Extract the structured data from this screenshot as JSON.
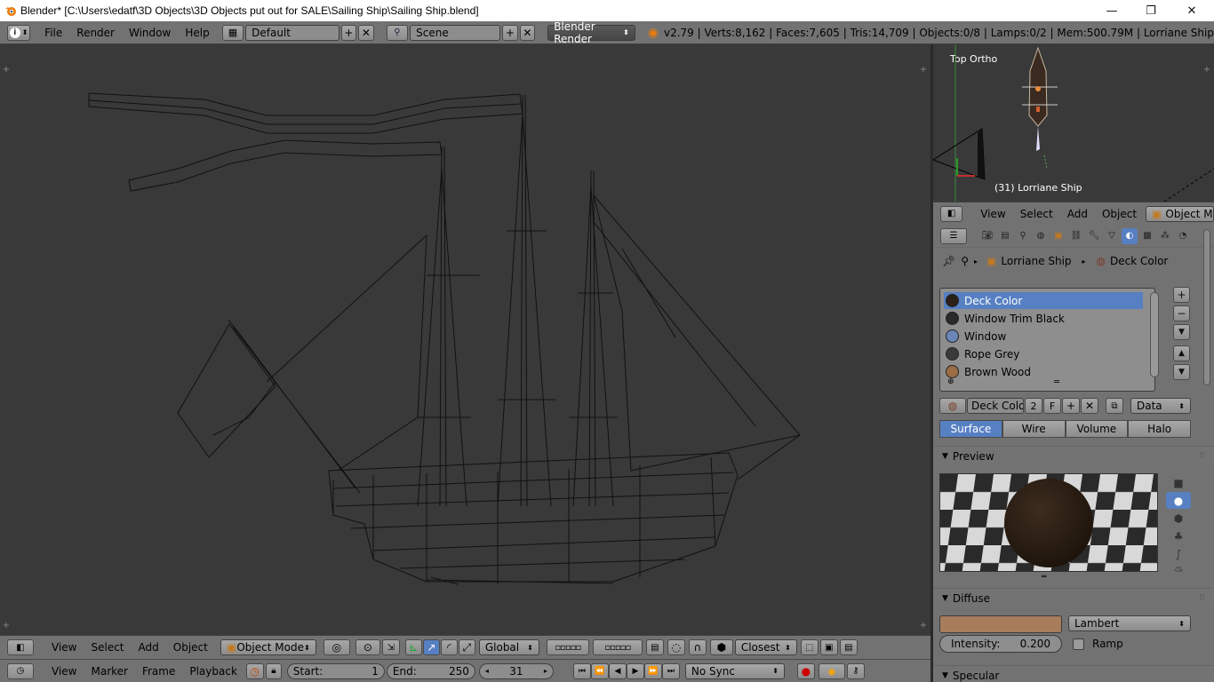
{
  "window": {
    "title": "Blender* [C:\\Users\\edatf\\3D Objects\\3D Objects put out for SALE\\Sailing Ship\\Sailing Ship.blend]",
    "minimize": "—",
    "maximize": "❐",
    "close": "✕"
  },
  "info_header": {
    "menus": [
      "File",
      "Render",
      "Window",
      "Help"
    ],
    "screen_layout": "Default",
    "scene": "Scene",
    "render_engine": "Blender Render",
    "stats": "v2.79 | Verts:8,162 | Faces:7,605 | Tris:14,709 | Objects:0/8 | Lamps:0/2 | Mem:500.79M | Lorriane Ship"
  },
  "viewport_header": {
    "menus": [
      "View",
      "Select",
      "Add",
      "Object"
    ],
    "mode": "Object Mode",
    "transform_orientation": "Global",
    "snap_element": "Closest"
  },
  "timeline": {
    "menus": [
      "View",
      "Marker",
      "Frame",
      "Playback"
    ],
    "start_label": "Start:",
    "start_value": "1",
    "end_label": "End:",
    "end_value": "250",
    "current_frame": "31",
    "sync": "No Sync"
  },
  "mini_view": {
    "view_label": "Top Ortho",
    "object_label": "(31) Lorriane Ship",
    "menus": [
      "View",
      "Select",
      "Add",
      "Object"
    ],
    "mode": "Object Mode"
  },
  "properties": {
    "breadcrumb_object": "Lorriane Ship",
    "breadcrumb_material": "Deck Color",
    "materials": [
      {
        "name": "Deck Color",
        "color": "#2b2118",
        "selected": true
      },
      {
        "name": "Window Trim Black",
        "color": "#2a2a2a",
        "selected": false
      },
      {
        "name": "Window",
        "color": "#6b86b8",
        "selected": false
      },
      {
        "name": "Rope Grey",
        "color": "#3a3a3a",
        "selected": false
      },
      {
        "name": "Brown Wood",
        "color": "#9b6d45",
        "selected": false
      }
    ],
    "material_name": "Deck Color",
    "user_count": "2",
    "fake_user": "F",
    "link": "Data",
    "type_tabs": [
      "Surface",
      "Wire",
      "Volume",
      "Halo"
    ],
    "active_type_tab": "Surface",
    "preview_label": "Preview",
    "diffuse_label": "Diffuse",
    "diffuse_color": "#a87d5c",
    "diffuse_shader": "Lambert",
    "intensity_label": "Intensity:",
    "intensity_value": "0.200",
    "ramp_label": "Ramp",
    "specular_label": "Specular"
  }
}
